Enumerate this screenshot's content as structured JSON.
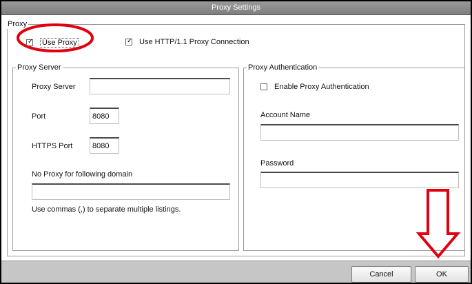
{
  "window": {
    "title": "Proxy Settings"
  },
  "proxy_group": {
    "legend": "Proxy",
    "use_proxy": {
      "label": "Use Proxy",
      "checked": true
    },
    "use_http11": {
      "label": "Use HTTP/1.1 Proxy Connection",
      "checked": true
    }
  },
  "server_group": {
    "legend": "Proxy Server",
    "proxy_server_label": "Proxy Server",
    "proxy_server_value": "",
    "port_label": "Port",
    "port_value": "8080",
    "https_port_label": "HTTPS Port",
    "https_port_value": "8080",
    "no_proxy_label": "No Proxy for following domain",
    "no_proxy_value": "",
    "hint": "Use commas (,) to separate multiple listings."
  },
  "auth_group": {
    "legend": "Proxy Authentication",
    "enable_auth": {
      "label": "Enable Proxy Authentication",
      "checked": false
    },
    "account_label": "Account Name",
    "account_value": "",
    "password_label": "Password",
    "password_value": ""
  },
  "buttons": {
    "cancel": "Cancel",
    "ok": "OK"
  },
  "annotations": {
    "highlight_color": "#e0000f"
  }
}
